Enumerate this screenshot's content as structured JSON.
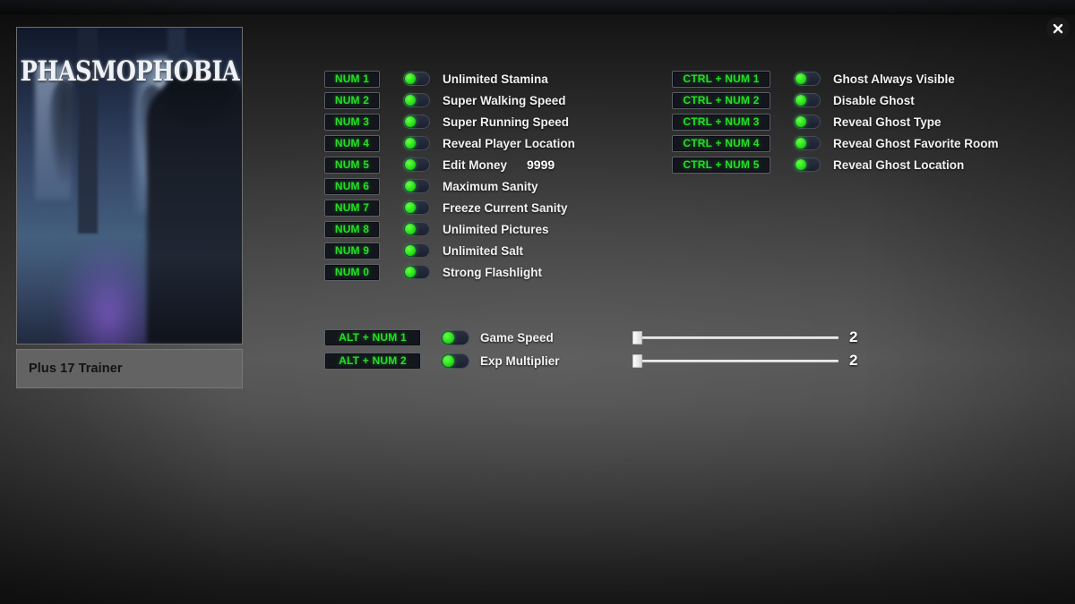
{
  "window": {
    "close_icon": "close-icon"
  },
  "cover": {
    "game_title": "PHASMOPHOBIA",
    "trainer_label": "Plus 17 Trainer"
  },
  "groups": {
    "left": {
      "rows": [
        {
          "hotkey": "NUM 1",
          "label": "Unlimited Stamina",
          "enabled": true
        },
        {
          "hotkey": "NUM 2",
          "label": "Super Walking Speed",
          "enabled": true
        },
        {
          "hotkey": "NUM 3",
          "label": "Super Running Speed",
          "enabled": true
        },
        {
          "hotkey": "NUM 4",
          "label": "Reveal Player Location",
          "enabled": true
        },
        {
          "hotkey": "NUM 5",
          "label": "Edit Money",
          "enabled": true,
          "value": "9999"
        },
        {
          "hotkey": "NUM 6",
          "label": "Maximum Sanity",
          "enabled": true
        },
        {
          "hotkey": "NUM 7",
          "label": "Freeze Current Sanity",
          "enabled": true
        },
        {
          "hotkey": "NUM 8",
          "label": "Unlimited Pictures",
          "enabled": true
        },
        {
          "hotkey": "NUM 9",
          "label": "Unlimited Salt",
          "enabled": true
        },
        {
          "hotkey": "NUM 0",
          "label": "Strong Flashlight",
          "enabled": true
        }
      ]
    },
    "right": {
      "rows": [
        {
          "hotkey": "CTRL + NUM 1",
          "label": "Ghost Always Visible",
          "enabled": true
        },
        {
          "hotkey": "CTRL + NUM 2",
          "label": "Disable Ghost",
          "enabled": true
        },
        {
          "hotkey": "CTRL + NUM 3",
          "label": "Reveal Ghost Type",
          "enabled": true
        },
        {
          "hotkey": "CTRL + NUM 4",
          "label": "Reveal Ghost Favorite Room",
          "enabled": true
        },
        {
          "hotkey": "CTRL + NUM 5",
          "label": "Reveal Ghost Location",
          "enabled": true
        }
      ]
    },
    "bottom": {
      "rows": [
        {
          "hotkey": "ALT + NUM 1",
          "label": "Game Speed",
          "enabled": true,
          "slider_value": "2",
          "slider_percent": 0
        },
        {
          "hotkey": "ALT + NUM 2",
          "label": "Exp Multiplier",
          "enabled": true,
          "slider_value": "2",
          "slider_percent": 0
        }
      ]
    }
  },
  "colors": {
    "hotkey_text": "#22e022",
    "toggle_on": "#22dd18",
    "label_text": "#f2f2f2",
    "trainer_bar": "#636363"
  }
}
